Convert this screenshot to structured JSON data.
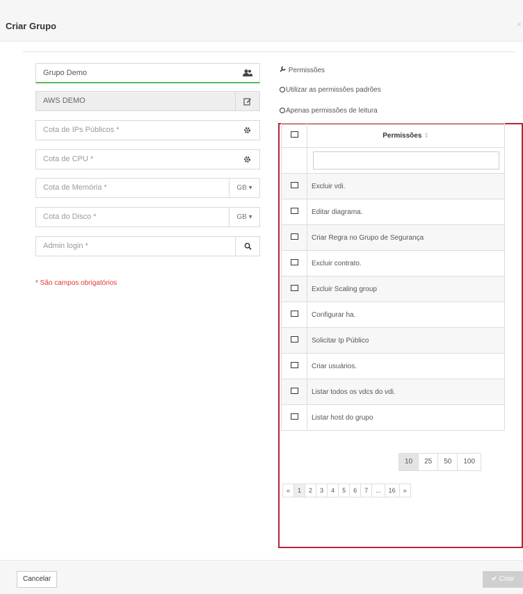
{
  "modal": {
    "title": "Criar Grupo",
    "close": "×"
  },
  "form": {
    "group_name": "Grupo Demo",
    "account": "AWS DEMO",
    "public_ip_placeholder": "Cota de IPs Públicos *",
    "public_ip_suffix": "...",
    "cpu_placeholder": "Cota de CPU *",
    "memory_placeholder": "Cota de Memória *",
    "memory_unit": "GB ▾",
    "disk_placeholder": "Cota do Disco *",
    "disk_unit": "GB ▾",
    "admin_placeholder": "Admin login *",
    "required_note": "* São campos obrigatórios"
  },
  "permissions": {
    "title": "Permissões",
    "option_default": "Utilizar as permissões padrões",
    "option_readonly": "Apenas permissões de leitura",
    "column_header": "Permissões",
    "search_value": "",
    "rows": [
      "Excluir vdi.",
      "Editar diagrama.",
      "Criar Regra no Grupo de Segurança",
      "Excluir contrato.",
      "Excluir Scaling group",
      "Configurar ha.",
      "Solicitar Ip Público",
      "Criar usuários.",
      "Listar todos os vdcs do vdi.",
      "Listar host do grupo"
    ],
    "page_sizes": [
      "10",
      "25",
      "50",
      "100"
    ],
    "active_page_size": "10",
    "pages": [
      "«",
      "1",
      "2",
      "3",
      "4",
      "5",
      "6",
      "7",
      "...",
      "16",
      "»"
    ],
    "active_page": "1"
  },
  "footer": {
    "cancel": "Cancelar",
    "create": "✔ Criar"
  },
  "colors": {
    "highlight_border": "#b7252d",
    "valid_green": "#5cb85c",
    "required_red": "#e03838"
  }
}
